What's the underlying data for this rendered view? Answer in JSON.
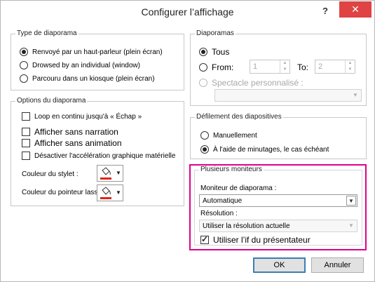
{
  "window": {
    "title": "Configurer l’affichage",
    "help_label": "?",
    "close_label": "✕"
  },
  "slide_show_type": {
    "title": "Type de diaporama",
    "options": [
      {
        "label": "Renvoyé par un haut-parleur (plein écran)",
        "checked": true
      },
      {
        "label": "Drowsed by an individual (window)",
        "checked": false
      },
      {
        "label": "Parcouru dans un kiosque (plein écran)",
        "checked": false
      }
    ]
  },
  "slides": {
    "title": "Diaporamas",
    "all_label": "Tous",
    "from_label": "From:",
    "from_value": "1",
    "to_label": "To:",
    "to_value": "2",
    "custom_label": "Spectacle personnalisé :",
    "custom_value": ""
  },
  "options": {
    "title": "Options du diaporama",
    "loop_label": "Loop en continu jusqu'à « Échap »",
    "no_narration_label": "Afficher sans narration",
    "no_animation_label": "Afficher sans animation",
    "disable_hw_label": "Désactiver l'accélération graphique matérielle",
    "pen_color_label": "Couleur du stylet :",
    "laser_color_label": "Couleur du pointeur lass :",
    "pen_color": "#e2231a",
    "laser_color": "#e2231a"
  },
  "advance": {
    "title": "Défilement des diapositives",
    "manual_label": "Manuellement",
    "timings_label": "À l'aide de minutages, le cas échéant"
  },
  "monitors": {
    "title": "Plusieurs moniteurs",
    "monitor_label": "Moniteur de diaporama :",
    "monitor_value": "Automatique",
    "resolution_label": "Résolution :",
    "resolution_value": "Utiliser la résolution actuelle",
    "presenter_label": "Utiliser l’if du présentateur",
    "presenter_checked": true,
    "highlight_color": "#e0008a"
  },
  "buttons": {
    "ok_label": "OK",
    "cancel_label": "Annuler"
  }
}
